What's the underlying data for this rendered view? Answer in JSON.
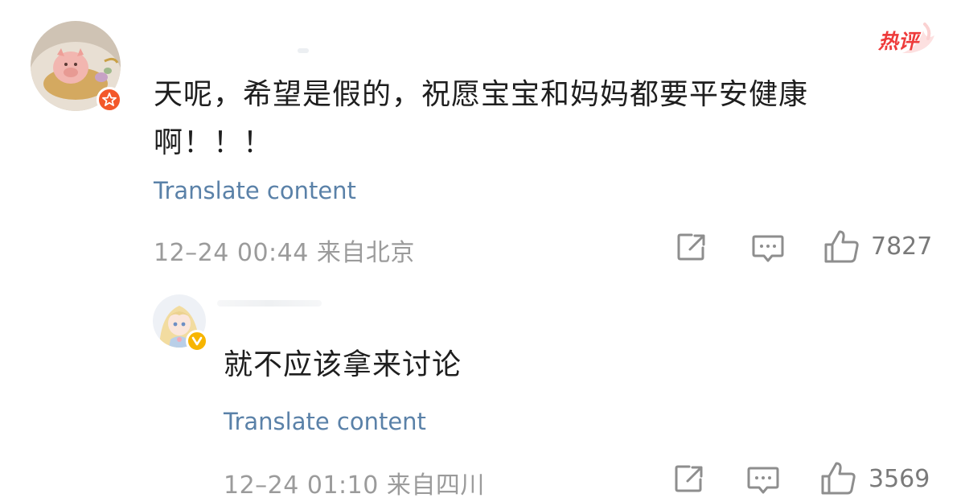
{
  "comment": {
    "avatar_icon": "pig-avatar",
    "badge_icon": "star-badge-icon",
    "hot_tag": "热评",
    "text": "天呢，希望是假的，祝愿宝宝和妈妈都要平安健康啊！！！",
    "translate_label": "Translate content",
    "time": "12–24 00:44",
    "location": "来自北京",
    "actions": {
      "share_icon": "share-icon",
      "reply_icon": "comment-icon",
      "like_icon": "thumbs-up-icon",
      "like_count": "7827"
    }
  },
  "reply": {
    "avatar_icon": "anime-girl-avatar",
    "badge_icon": "verified-v-badge-icon",
    "text": "就不应该拿来讨论",
    "translate_label": "Translate content",
    "time": "12–24 01:10",
    "location": "来自四川",
    "actions": {
      "share_icon": "share-icon",
      "reply_icon": "comment-icon",
      "like_icon": "thumbs-up-icon",
      "like_count": "3569"
    }
  },
  "colors": {
    "link": "#5a81a8",
    "meta": "#9b9b9b",
    "hot_tag": "#ee3b3b",
    "badge_red": "#f3582a",
    "badge_gold": "#f7b500"
  }
}
